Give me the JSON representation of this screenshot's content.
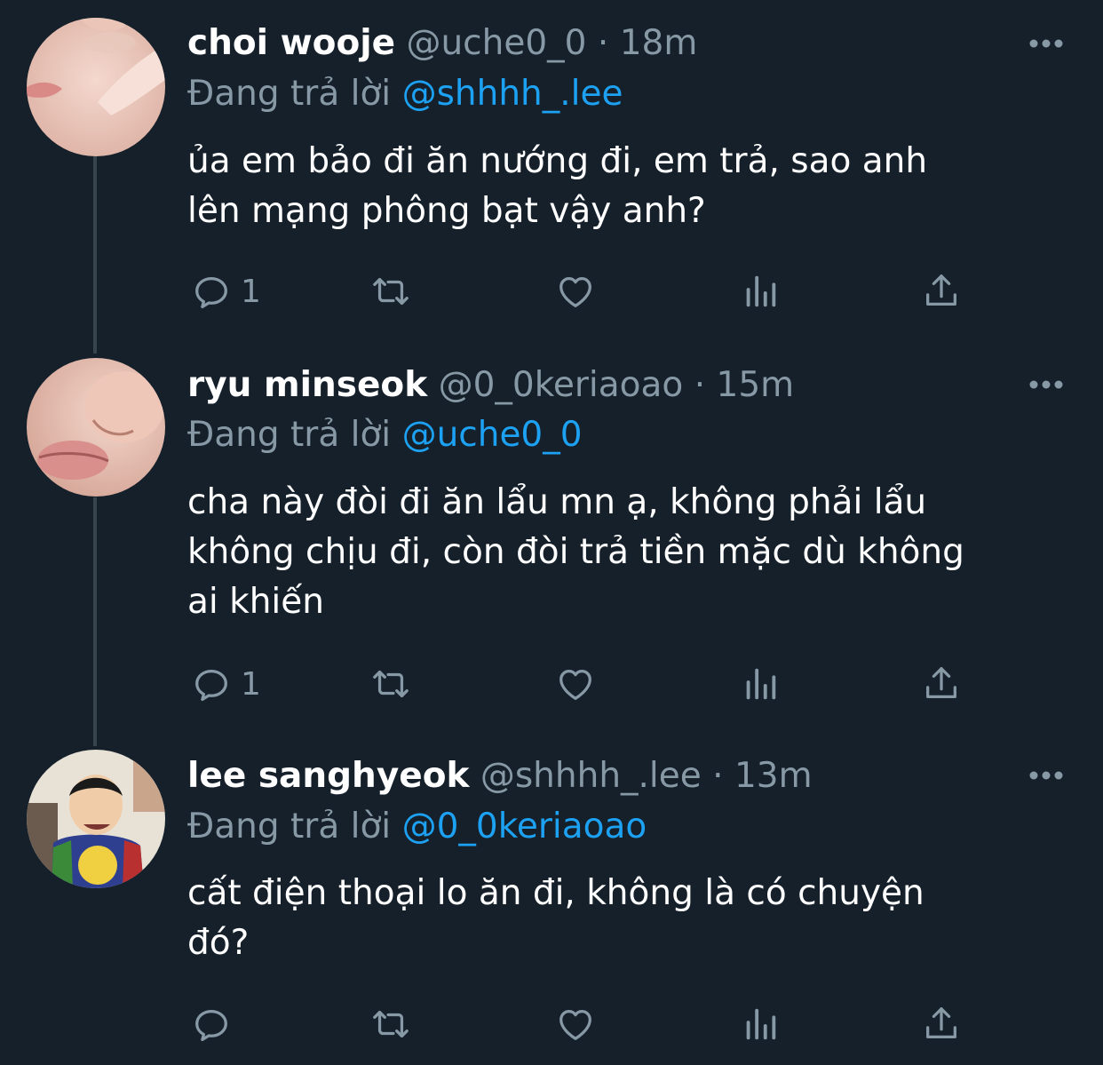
{
  "theme": {
    "background": "#15202b",
    "secondary_text": "#8899a6",
    "link": "#1da1f2",
    "thread_line": "#38444d"
  },
  "tweets": [
    {
      "name": "choi wooje",
      "handle": "@uche0_0",
      "separator": "·",
      "time": "18m",
      "replying_prefix": "Đang trả lời",
      "replying_to": "@shhhh_.lee",
      "text": "ủa em bảo đi ăn nướng đi, em trả, sao anh\nlên mạng phông bạt vậy anh?",
      "reply_count": "1",
      "icons": [
        "reply-icon",
        "retweet-icon",
        "like-icon",
        "analytics-icon",
        "share-icon"
      ]
    },
    {
      "name": "ryu minseok",
      "handle": "@0_0keriaoao",
      "separator": "·",
      "time": "15m",
      "replying_prefix": "Đang trả lời",
      "replying_to": "@uche0_0",
      "text": "cha này đòi đi ăn lẩu mn ạ, không phải lẩu\nkhông chịu đi, còn đòi trả tiền mặc dù không\nai khiến",
      "reply_count": "1",
      "icons": [
        "reply-icon",
        "retweet-icon",
        "like-icon",
        "analytics-icon",
        "share-icon"
      ]
    },
    {
      "name": "lee sanghyeok",
      "handle": "@shhhh_.lee",
      "separator": "·",
      "time": "13m",
      "replying_prefix": "Đang trả lời",
      "replying_to": "@0_0keriaoao",
      "text": "cất điện thoại lo ăn đi, không là có chuyện\nđó?",
      "reply_count": "",
      "icons": [
        "reply-icon",
        "retweet-icon",
        "like-icon",
        "analytics-icon",
        "share-icon"
      ]
    }
  ]
}
